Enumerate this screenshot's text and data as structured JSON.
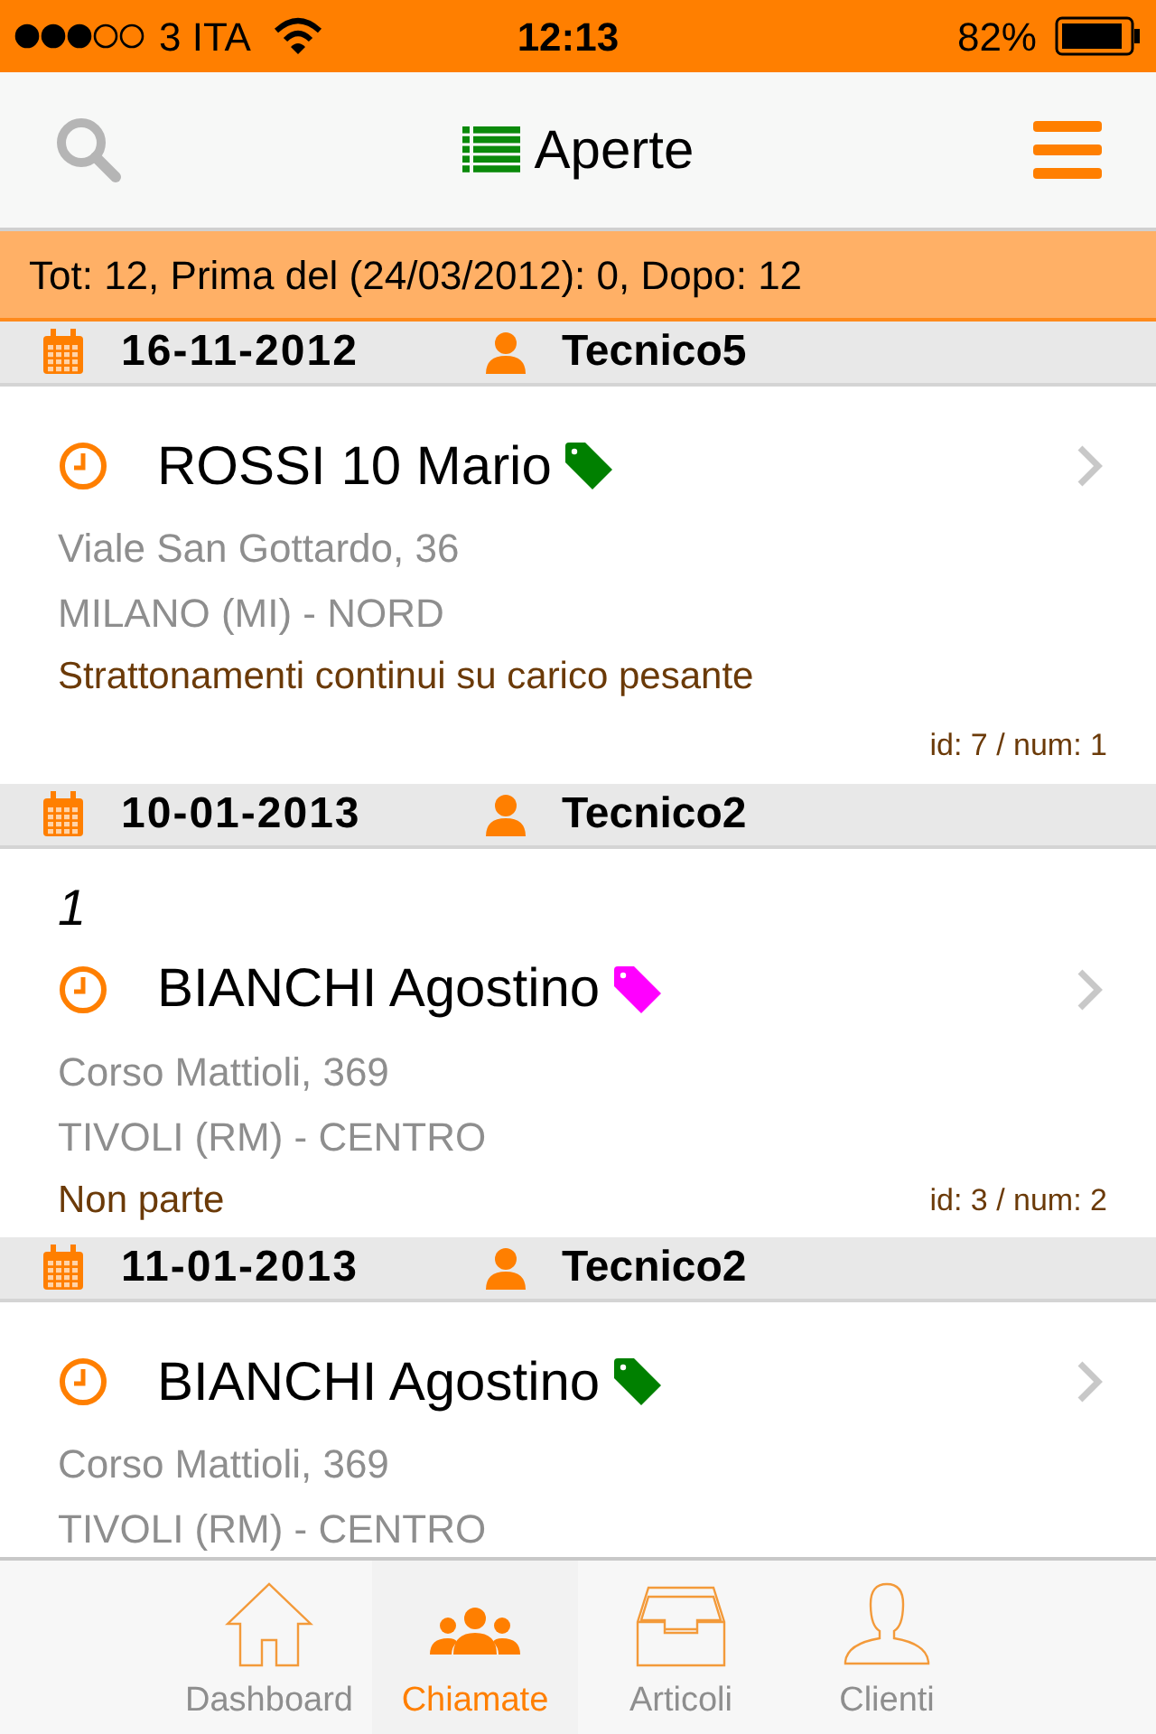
{
  "status_bar": {
    "carrier": "3 ITA",
    "time": "12:13",
    "battery": "82%"
  },
  "header": {
    "title": "Aperte"
  },
  "summary": "Tot: 12, Prima del (24/03/2012): 0, Dopo: 12",
  "groups": [
    {
      "date": "16-11-2012",
      "technician": "Tecnico5",
      "call": {
        "name": "ROSSI 10 Mario",
        "color": "#008000",
        "address": "Viale San Gottardo, 36",
        "city": "MILANO (MI) - NORD",
        "note": "Strattonamenti continui su carico pesante",
        "ref": "id: 7 / num: 1"
      }
    },
    {
      "date": "10-01-2013",
      "technician": "Tecnico2",
      "call": {
        "number": "1",
        "name": "BIANCHI Agostino",
        "color": "#ff00ff",
        "address": "Corso Mattioli, 369",
        "city": "TIVOLI (RM) - CENTRO",
        "note": "Non parte",
        "ref": "id: 3 / num: 2"
      }
    },
    {
      "date": "11-01-2013",
      "technician": "Tecnico2",
      "call": {
        "name": "BIANCHI Agostino",
        "color": "#008000",
        "address": "Corso Mattioli, 369",
        "city": "TIVOLI (RM) - CENTRO"
      }
    }
  ],
  "tabs": [
    {
      "label": "Dashboard",
      "kind": "home",
      "selected": false
    },
    {
      "label": "Chiamate",
      "kind": "people",
      "selected": true
    },
    {
      "label": "Articoli",
      "kind": "tray",
      "selected": false
    },
    {
      "label": "Clienti",
      "kind": "person",
      "selected": false
    }
  ]
}
